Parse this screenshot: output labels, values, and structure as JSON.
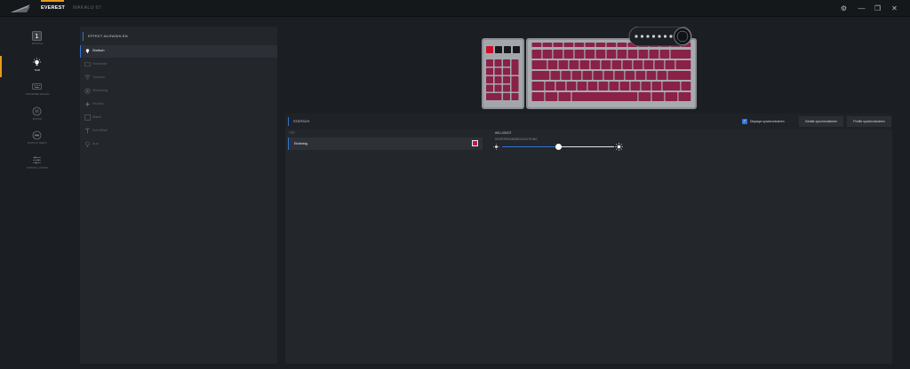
{
  "app": {
    "tabs": [
      {
        "label": "EVEREST",
        "active": true
      },
      {
        "label": "MAKALU 67",
        "active": false
      }
    ]
  },
  "colors": {
    "accent_blue": "#2f74d9",
    "accent_orange": "#e89a1c",
    "effect_color": "#c2174d",
    "key_color": "#8a2147"
  },
  "nav": {
    "items": [
      {
        "label": "PROFILE",
        "icon": "profile-number-icon",
        "badge": "1"
      },
      {
        "label": "RGB",
        "icon": "bulb-icon",
        "active": true
      },
      {
        "label": "TASTENBELEGUNG",
        "icon": "keyboard-icon"
      },
      {
        "label": "MAKRO",
        "icon": "macro-icon"
      },
      {
        "label": "DISPLAY-MENÜ",
        "icon": "display-menu-icon"
      },
      {
        "label": "EINSTELLUNGEN",
        "icon": "sliders-icon"
      }
    ]
  },
  "effects": {
    "header": "EFFEKT AUSWÄHLEN",
    "items": [
      {
        "label": "Statisch",
        "icon": "bulb-icon",
        "active": true
      },
      {
        "label": "Farbwelle",
        "icon": "wave-keyboard-icon"
      },
      {
        "label": "Tornado",
        "icon": "tornado-icon"
      },
      {
        "label": "Wirbelung",
        "icon": "swirl-icon"
      },
      {
        "label": "Reaktiv",
        "icon": "reactive-icon"
      },
      {
        "label": "Matrix",
        "icon": "matrix-icon"
      },
      {
        "label": "Schrifthall",
        "icon": "text-icon"
      },
      {
        "label": "Aus",
        "icon": "off-icon"
      }
    ]
  },
  "settings": {
    "title": "STATISCH",
    "sync_displays_label": "Displays synchronisieren",
    "sync_displays_checked": true,
    "sync_devices_label": "Geräte synchronisieren",
    "sync_profiles_label": "Profile synchronisieren",
    "type_label": "TYP",
    "type_value": "Einfarbig",
    "brightness_label": "HELLIGKEIT",
    "bg_brightness_label": "HINTERGRUNDBELEUCHTUNG",
    "brightness_value": 0.5
  }
}
